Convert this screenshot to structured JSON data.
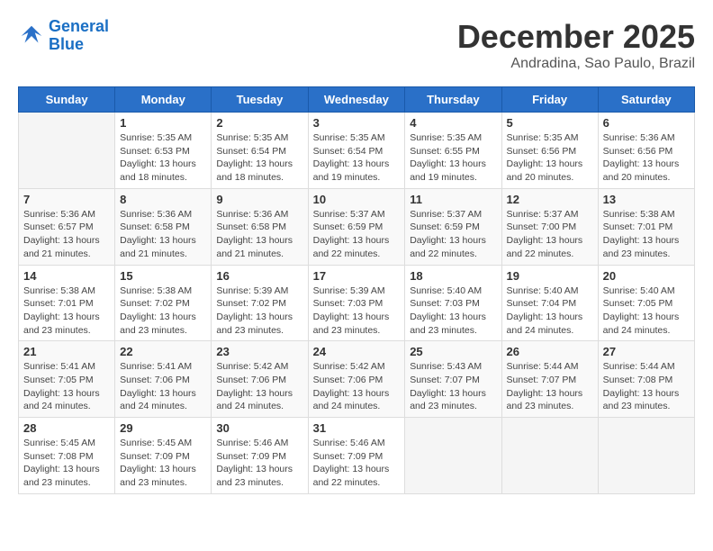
{
  "header": {
    "logo_line1": "General",
    "logo_line2": "Blue",
    "month": "December 2025",
    "location": "Andradina, Sao Paulo, Brazil"
  },
  "days_of_week": [
    "Sunday",
    "Monday",
    "Tuesday",
    "Wednesday",
    "Thursday",
    "Friday",
    "Saturday"
  ],
  "weeks": [
    [
      {
        "day": "",
        "content": ""
      },
      {
        "day": "1",
        "content": "Sunrise: 5:35 AM\nSunset: 6:53 PM\nDaylight: 13 hours\nand 18 minutes."
      },
      {
        "day": "2",
        "content": "Sunrise: 5:35 AM\nSunset: 6:54 PM\nDaylight: 13 hours\nand 18 minutes."
      },
      {
        "day": "3",
        "content": "Sunrise: 5:35 AM\nSunset: 6:54 PM\nDaylight: 13 hours\nand 19 minutes."
      },
      {
        "day": "4",
        "content": "Sunrise: 5:35 AM\nSunset: 6:55 PM\nDaylight: 13 hours\nand 19 minutes."
      },
      {
        "day": "5",
        "content": "Sunrise: 5:35 AM\nSunset: 6:56 PM\nDaylight: 13 hours\nand 20 minutes."
      },
      {
        "day": "6",
        "content": "Sunrise: 5:36 AM\nSunset: 6:56 PM\nDaylight: 13 hours\nand 20 minutes."
      }
    ],
    [
      {
        "day": "7",
        "content": "Sunrise: 5:36 AM\nSunset: 6:57 PM\nDaylight: 13 hours\nand 21 minutes."
      },
      {
        "day": "8",
        "content": "Sunrise: 5:36 AM\nSunset: 6:58 PM\nDaylight: 13 hours\nand 21 minutes."
      },
      {
        "day": "9",
        "content": "Sunrise: 5:36 AM\nSunset: 6:58 PM\nDaylight: 13 hours\nand 21 minutes."
      },
      {
        "day": "10",
        "content": "Sunrise: 5:37 AM\nSunset: 6:59 PM\nDaylight: 13 hours\nand 22 minutes."
      },
      {
        "day": "11",
        "content": "Sunrise: 5:37 AM\nSunset: 6:59 PM\nDaylight: 13 hours\nand 22 minutes."
      },
      {
        "day": "12",
        "content": "Sunrise: 5:37 AM\nSunset: 7:00 PM\nDaylight: 13 hours\nand 22 minutes."
      },
      {
        "day": "13",
        "content": "Sunrise: 5:38 AM\nSunset: 7:01 PM\nDaylight: 13 hours\nand 23 minutes."
      }
    ],
    [
      {
        "day": "14",
        "content": "Sunrise: 5:38 AM\nSunset: 7:01 PM\nDaylight: 13 hours\nand 23 minutes."
      },
      {
        "day": "15",
        "content": "Sunrise: 5:38 AM\nSunset: 7:02 PM\nDaylight: 13 hours\nand 23 minutes."
      },
      {
        "day": "16",
        "content": "Sunrise: 5:39 AM\nSunset: 7:02 PM\nDaylight: 13 hours\nand 23 minutes."
      },
      {
        "day": "17",
        "content": "Sunrise: 5:39 AM\nSunset: 7:03 PM\nDaylight: 13 hours\nand 23 minutes."
      },
      {
        "day": "18",
        "content": "Sunrise: 5:40 AM\nSunset: 7:03 PM\nDaylight: 13 hours\nand 23 minutes."
      },
      {
        "day": "19",
        "content": "Sunrise: 5:40 AM\nSunset: 7:04 PM\nDaylight: 13 hours\nand 24 minutes."
      },
      {
        "day": "20",
        "content": "Sunrise: 5:40 AM\nSunset: 7:05 PM\nDaylight: 13 hours\nand 24 minutes."
      }
    ],
    [
      {
        "day": "21",
        "content": "Sunrise: 5:41 AM\nSunset: 7:05 PM\nDaylight: 13 hours\nand 24 minutes."
      },
      {
        "day": "22",
        "content": "Sunrise: 5:41 AM\nSunset: 7:06 PM\nDaylight: 13 hours\nand 24 minutes."
      },
      {
        "day": "23",
        "content": "Sunrise: 5:42 AM\nSunset: 7:06 PM\nDaylight: 13 hours\nand 24 minutes."
      },
      {
        "day": "24",
        "content": "Sunrise: 5:42 AM\nSunset: 7:06 PM\nDaylight: 13 hours\nand 24 minutes."
      },
      {
        "day": "25",
        "content": "Sunrise: 5:43 AM\nSunset: 7:07 PM\nDaylight: 13 hours\nand 23 minutes."
      },
      {
        "day": "26",
        "content": "Sunrise: 5:44 AM\nSunset: 7:07 PM\nDaylight: 13 hours\nand 23 minutes."
      },
      {
        "day": "27",
        "content": "Sunrise: 5:44 AM\nSunset: 7:08 PM\nDaylight: 13 hours\nand 23 minutes."
      }
    ],
    [
      {
        "day": "28",
        "content": "Sunrise: 5:45 AM\nSunset: 7:08 PM\nDaylight: 13 hours\nand 23 minutes."
      },
      {
        "day": "29",
        "content": "Sunrise: 5:45 AM\nSunset: 7:09 PM\nDaylight: 13 hours\nand 23 minutes."
      },
      {
        "day": "30",
        "content": "Sunrise: 5:46 AM\nSunset: 7:09 PM\nDaylight: 13 hours\nand 23 minutes."
      },
      {
        "day": "31",
        "content": "Sunrise: 5:46 AM\nSunset: 7:09 PM\nDaylight: 13 hours\nand 22 minutes."
      },
      {
        "day": "",
        "content": ""
      },
      {
        "day": "",
        "content": ""
      },
      {
        "day": "",
        "content": ""
      }
    ]
  ]
}
